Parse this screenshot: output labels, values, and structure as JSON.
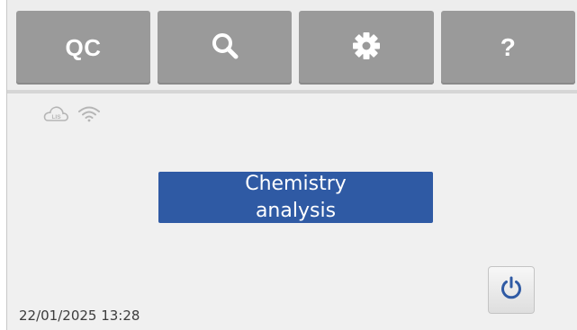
{
  "toolbar": {
    "qc_label": "QC",
    "search_icon": "search-icon",
    "settings_icon": "gear-icon",
    "help_label": "?"
  },
  "status": {
    "cloud_label": "LIS",
    "icons": [
      "cloud-icon",
      "wifi-icon"
    ]
  },
  "main": {
    "action_label": "Chemistry analysis"
  },
  "footer": {
    "datetime": "22/01/2025 13:28",
    "power_icon": "power-icon"
  },
  "colors": {
    "toolbar_button": "#9a9a9a",
    "primary_button": "#2f5aa4",
    "power_icon": "#2f5aa4",
    "background": "#f0f0f0"
  }
}
